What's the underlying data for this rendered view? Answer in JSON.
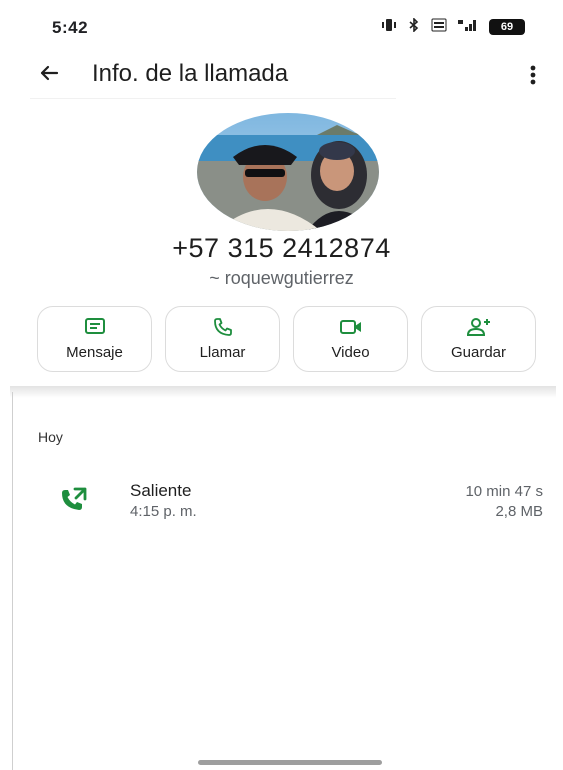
{
  "status_bar": {
    "time": "5:42",
    "icons": [
      "vibrate-icon",
      "bluetooth-icon",
      "volte-icon",
      "signal-4g-icon"
    ],
    "battery_level": "69"
  },
  "app_bar": {
    "title": "Info. de la llamada",
    "back_icon": "arrow-back-icon",
    "more_icon": "more-vert-icon"
  },
  "contact": {
    "phone": "+57 315 2412874",
    "username": "~ roquewgutierrez"
  },
  "actions": [
    {
      "label": "Mensaje",
      "icon": "message-icon"
    },
    {
      "label": "Llamar",
      "icon": "phone-icon"
    },
    {
      "label": "Video",
      "icon": "videocam-icon"
    },
    {
      "label": "Guardar",
      "icon": "person-add-icon"
    }
  ],
  "history": {
    "section_label": "Hoy",
    "calls": [
      {
        "type": "Saliente",
        "time": "4:15 p. m.",
        "duration": "10 min 47 s",
        "size": "2,8 MB",
        "icon": "outgoing-call-icon"
      }
    ]
  },
  "colors": {
    "accent": "#1e8e3e",
    "text_primary": "#1f1f1f",
    "text_secondary": "#5f6368",
    "border": "#dcdcdc"
  }
}
